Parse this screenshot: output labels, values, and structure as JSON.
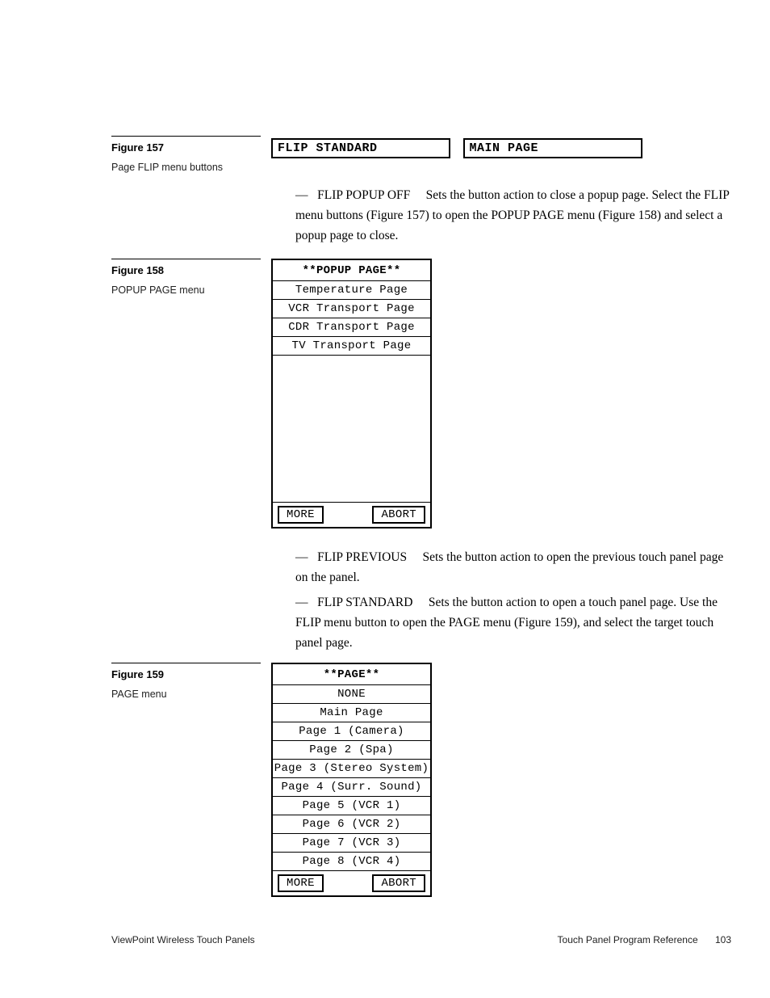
{
  "figure157": {
    "title": "Figure 157",
    "caption": "Page FLIP menu buttons",
    "buttons": {
      "left": "FLIP STANDARD",
      "right": "MAIN PAGE"
    }
  },
  "para_popup_off": {
    "lead_bold": "FLIP POPUP OFF",
    "remainder": "Sets the button action to close a popup page. Select the FLIP menu buttons (Figure 157) to open the POPUP PAGE menu (Figure 158) and select a popup page to close."
  },
  "figure158": {
    "title": "Figure 158",
    "caption": "POPUP PAGE menu",
    "menu": {
      "title": "**POPUP PAGE**",
      "items": [
        "Temperature Page",
        "VCR Transport Page",
        "CDR Transport Page",
        "TV Transport Page"
      ],
      "more": "MORE",
      "abort": "ABORT"
    }
  },
  "para_previous": {
    "lead_bold": "FLIP PREVIOUS",
    "remainder": "Sets the button action to open the previous touch panel page on the panel."
  },
  "para_standard": {
    "lead_bold": "FLIP STANDARD",
    "remainder": "Sets the button action to open a touch panel page. Use the FLIP menu button to open the PAGE menu (Figure 159), and select the target touch panel page."
  },
  "figure159": {
    "title": "Figure 159",
    "caption": "PAGE menu",
    "menu": {
      "title": "**PAGE**",
      "items": [
        "NONE",
        "Main Page",
        "Page 1 (Camera)",
        "Page 2 (Spa)",
        "Page 3 (Stereo System)",
        "Page 4 (Surr. Sound)",
        "Page 5 (VCR 1)",
        "Page 6 (VCR 2)",
        "Page 7 (VCR 3)",
        "Page 8 (VCR 4)"
      ],
      "more": "MORE",
      "abort": "ABORT"
    }
  },
  "footer": {
    "left": "ViewPoint Wireless Touch Panels",
    "right_label": "Touch Panel Program Reference",
    "page_num": "103"
  }
}
